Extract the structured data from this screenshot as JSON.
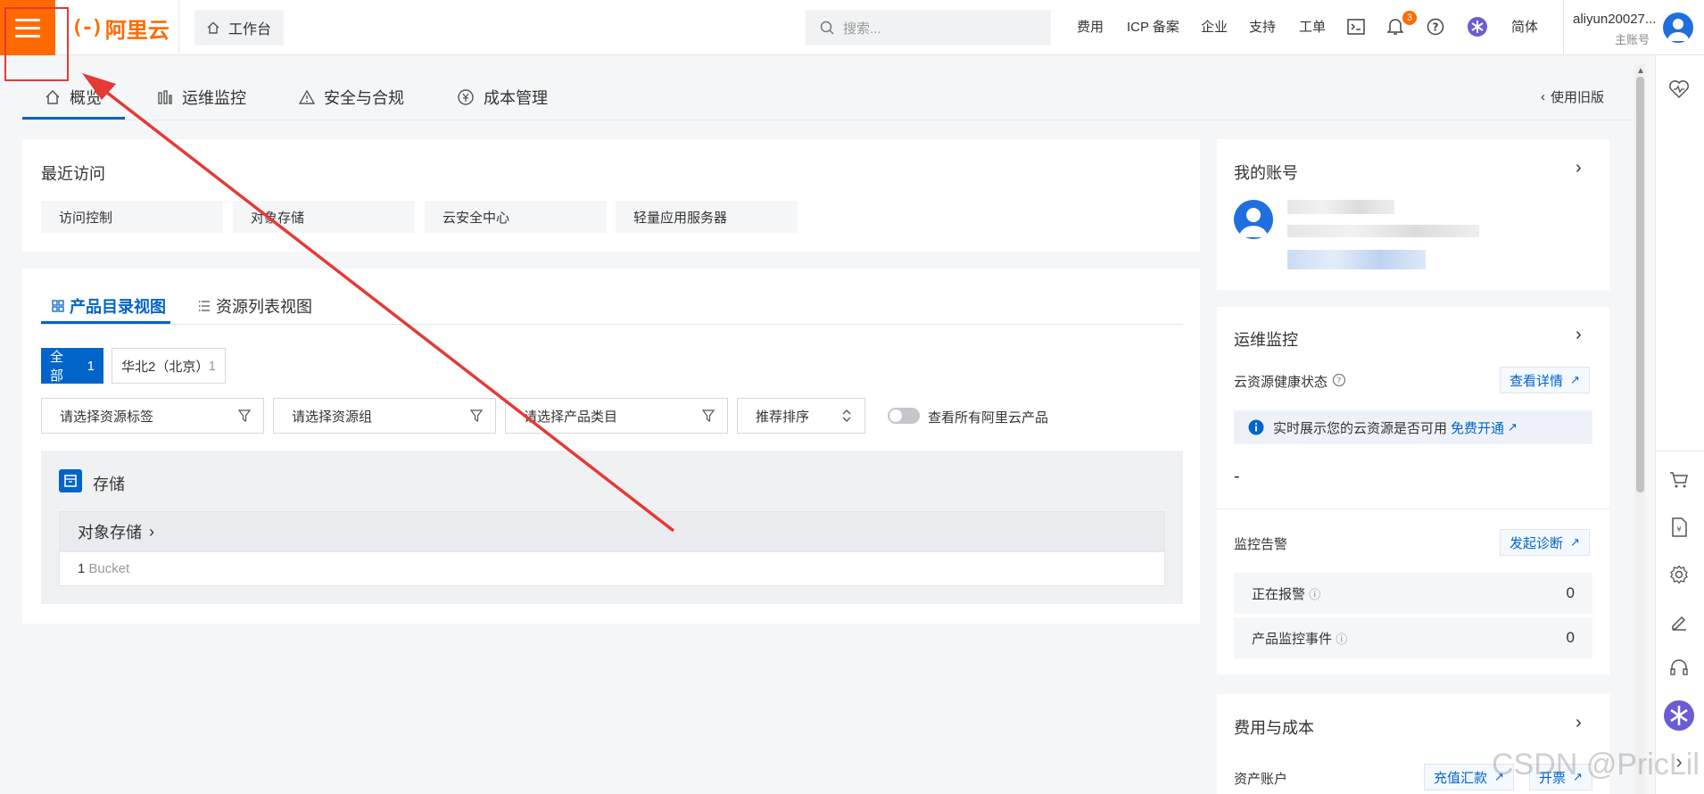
{
  "brand": {
    "name": "阿里云",
    "mark": "(-)",
    "accent": "#ff6a00"
  },
  "header": {
    "workbench": "工作台",
    "search_placeholder": "搜索...",
    "nav": [
      "费用",
      "ICP 备案",
      "企业",
      "支持",
      "工单"
    ],
    "bell_badge": "3",
    "language": "简体",
    "user_name": "aliyun20027...",
    "user_role": "主账号"
  },
  "tabs": [
    "概览",
    "运维监控",
    "安全与合规",
    "成本管理"
  ],
  "old_version": "使用旧版",
  "recent": {
    "title": "最近访问",
    "items": [
      "访问控制",
      "对象存储",
      "云安全中心",
      "轻量应用服务器"
    ]
  },
  "view_tabs": [
    "产品目录视图",
    "资源列表视图"
  ],
  "regions": [
    {
      "label": "全部",
      "count": "1"
    },
    {
      "label": "华北2（北京）",
      "count": "1"
    }
  ],
  "filters": {
    "tag": "请选择资源标签",
    "group": "请选择资源组",
    "category": "请选择产品类目",
    "sort": "推荐排序",
    "toggle_label": "查看所有阿里云产品"
  },
  "storage": {
    "title": "存储",
    "product": "对象存储",
    "count": "1",
    "unit": "Bucket"
  },
  "account": {
    "title": "我的账号"
  },
  "ops": {
    "title": "运维监控",
    "health_label": "云资源健康状态",
    "detail_btn": "查看详情",
    "info_text": "实时展示您的云资源是否可用",
    "info_link": "免费开通",
    "dash": "-",
    "alert_title": "监控告警",
    "diagnose_btn": "发起诊断",
    "alarming_label": "正在报警",
    "alarming_value": "0",
    "events_label": "产品监控事件",
    "events_value": "0"
  },
  "cost": {
    "title": "费用与成本",
    "asset_label": "资产账户",
    "recharge_btn": "充值汇款",
    "invoice_btn": "开票"
  },
  "watermark": "CSDN @PricLil"
}
